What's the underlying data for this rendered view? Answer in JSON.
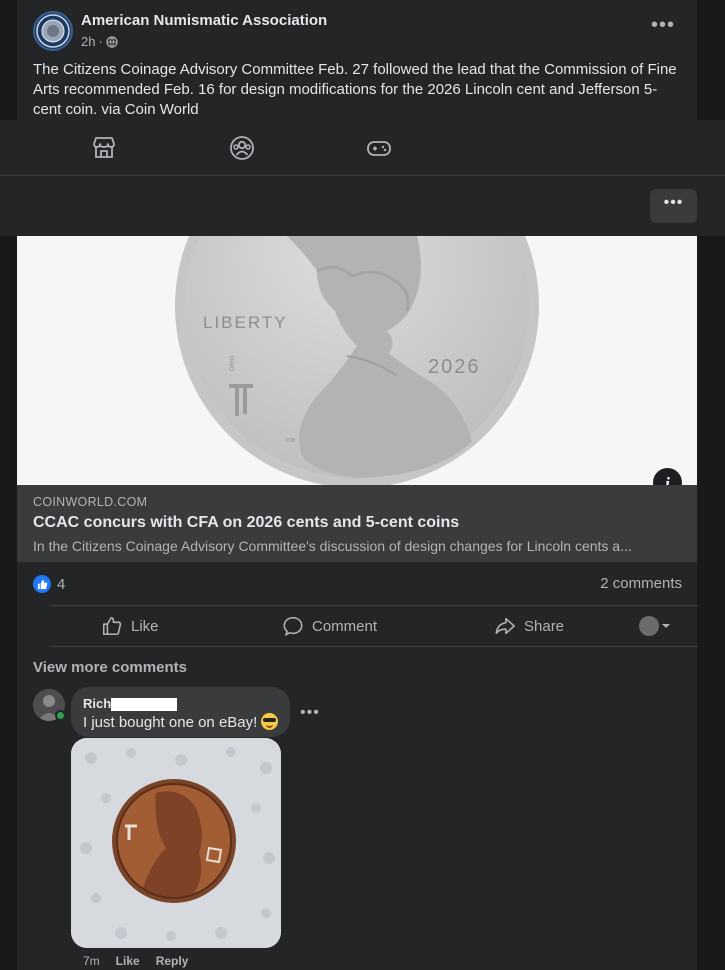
{
  "post": {
    "page_name": "American Numismatic Association",
    "time": "2h",
    "privacy_icon": "globe-icon",
    "text": "The Citizens Coinage Advisory Committee Feb. 27 followed the lead that the Commission of Fine Arts recommended Feb. 16 for design modifications for the 2026 Lincoln cent and Jefferson 5-cent coin. via Coin World"
  },
  "nav": {
    "icons": [
      "marketplace-icon",
      "groups-icon",
      "gaming-icon"
    ],
    "more_icon": "more-icon"
  },
  "link": {
    "image_text": {
      "liberty": "LIBERTY",
      "year": "2026",
      "mint": "ORIG",
      "initials": "VDB"
    },
    "domain": "COINWORLD.COM",
    "title": "CCAC concurs with CFA on 2026 cents and 5-cent coins",
    "description": "In the Citizens Coinage Advisory Committee's discussion of design changes for Lincoln cents a..."
  },
  "stats": {
    "likes": "4",
    "comments": "2 comments"
  },
  "actions": {
    "like": "Like",
    "comment": "Comment",
    "share": "Share"
  },
  "comments": {
    "view_more": "View more comments",
    "items": [
      {
        "name": "Rich",
        "text": "I just bought one on eBay!",
        "time": "7m",
        "like": "Like",
        "reply": "Reply"
      }
    ]
  },
  "colors": {
    "background": "#18191a",
    "card": "#242526",
    "accent": "#2078f4",
    "online": "#31a24c"
  }
}
